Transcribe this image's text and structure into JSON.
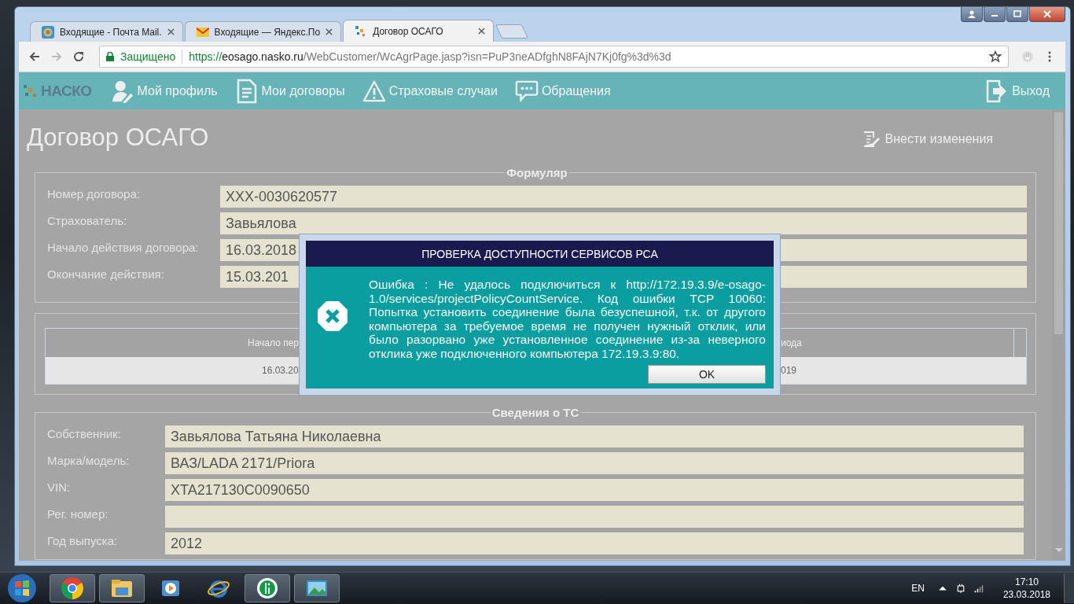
{
  "browser_tabs": [
    {
      "title": "Входящие - Почта Mail.",
      "selected": false
    },
    {
      "title": "Входящие — Яндекс.По",
      "selected": false
    },
    {
      "title": "Договор ОСАГО",
      "selected": true
    }
  ],
  "address_bar": {
    "security_label": "Защищено",
    "url_scheme": "https://",
    "url_host": "eosago.nasko.ru",
    "url_path": "/WebCustomer/WcAgrPage.jasp?isn=PuP3neADfghN8FAjN7Kj0fg%3d%3d"
  },
  "site_nav": {
    "logo": "НАСКО",
    "items": [
      "Мой профиль",
      "Мои договоры",
      "Страховые случаи",
      "Обращения"
    ],
    "logout": "Выход"
  },
  "page": {
    "title": "Договор ОСАГО",
    "edit_link": "Внести изменения",
    "policy_form": {
      "title": "Формуляр",
      "fields": [
        {
          "label": "Номер договора:",
          "value": "XXX-0030620577"
        },
        {
          "label": "Страхователь:",
          "value": "Завьялова"
        },
        {
          "label": "Начало действия договора:",
          "value": "16.03.2018"
        },
        {
          "label": "Окончание действия:",
          "value": "15.03.201"
        }
      ]
    },
    "periods_table": {
      "columns": [
        "Начало пер",
        "иода"
      ],
      "rows": [
        [
          "16.03.20",
          "019"
        ]
      ]
    },
    "vehicle_form": {
      "title": "Сведения о ТС",
      "fields": [
        {
          "label": "Собственник:",
          "value": "Завьялова Татьяна Николаевна"
        },
        {
          "label": "Марка/модель:",
          "value": "ВАЗ/LADA 2171/Priora"
        },
        {
          "label": "VIN:",
          "value": "XTA217130C0090650"
        },
        {
          "label": "Рег. номер:"
        },
        {
          "label": "Год выпуска:",
          "value": "2012"
        }
      ]
    }
  },
  "dialog": {
    "title": "ПРОВЕРКА ДОСТУПНОСТИ СЕРВИСОВ РСА",
    "message": "Ошибка : Не удалось подключиться к http://172.19.3.9/e-osago-1.0/services/projectPolicyCountService. Код ошибки TCP 10060: Попытка установить соединение была безуспешной, т.к. от другого компьютера за требуемое время не получен нужный отклик, или было разорвано уже установленное соединение из-за неверного отклика уже подключенного компьютера 172.19.3.9:80.",
    "button": "OK"
  },
  "taskbar": {
    "language": "EN",
    "time": "17:10",
    "date": "23.03.2018"
  }
}
